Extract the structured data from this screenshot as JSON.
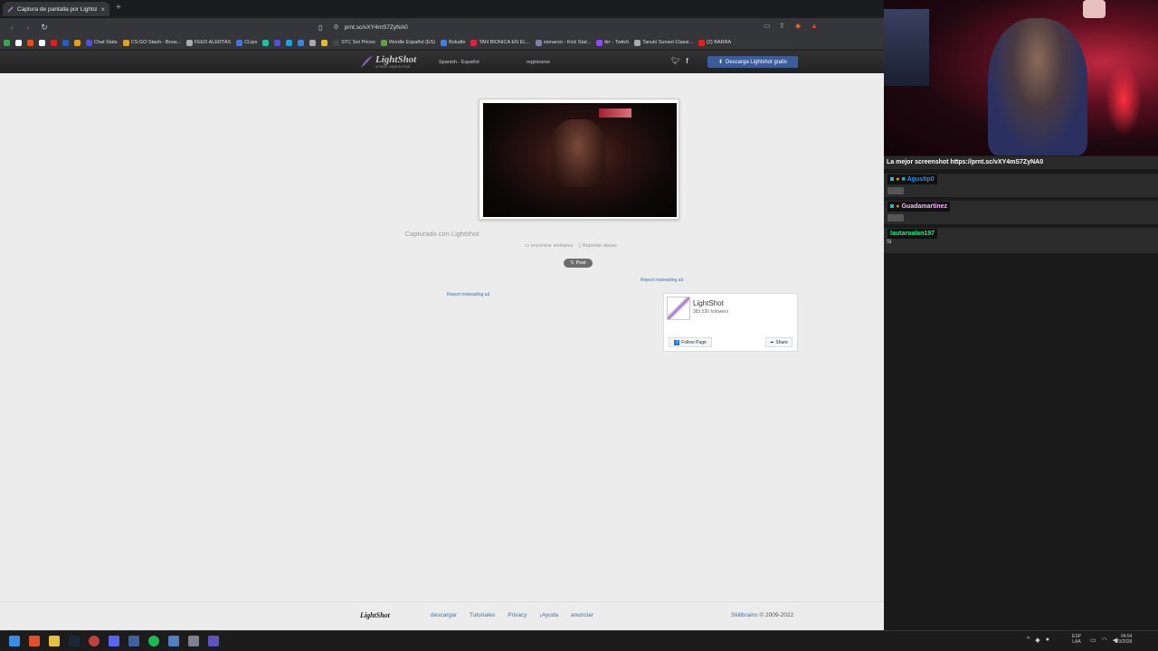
{
  "browser": {
    "tab_title": "Captura de pantalla por Lightshot",
    "tab_close": "×",
    "new_tab": "+",
    "url": "prnt.sc/vXY4mS7ZyNA0",
    "bookmarks": [
      {
        "label": "",
        "color": "#3aa655"
      },
      {
        "label": "",
        "color": "#ffffff"
      },
      {
        "label": "",
        "color": "#e94e1b"
      },
      {
        "label": "",
        "color": "#ffffff"
      },
      {
        "label": "",
        "color": "#e02020"
      },
      {
        "label": "",
        "color": "#2060c0"
      },
      {
        "label": "",
        "color": "#e0a020"
      },
      {
        "label": "Chat Stats",
        "color": "#5050e0"
      },
      {
        "label": "CS:GO Stash - Brow...",
        "color": "#e0a020"
      },
      {
        "label": "FEED ALERTAS",
        "color": "#aaaaaa"
      },
      {
        "label": "CLips",
        "color": "#4a70e0"
      },
      {
        "label": "",
        "color": "#20c0a0"
      },
      {
        "label": "",
        "color": "#5050e0"
      },
      {
        "label": "",
        "color": "#20a0e0"
      },
      {
        "label": "",
        "color": "#4080e0"
      },
      {
        "label": "",
        "color": "#aaaaaa"
      },
      {
        "label": "",
        "color": "#e0c020"
      },
      {
        "label": "STC Set Prices",
        "color": "#444444"
      },
      {
        "label": "Wordle Español (ES)",
        "color": "#60a040"
      },
      {
        "label": "Boludle",
        "color": "#4080e0"
      },
      {
        "label": "TAN BIONICA EN EL...",
        "color": "#e02040"
      },
      {
        "label": "sionaron - Kick Stat...",
        "color": "#8080a0"
      },
      {
        "label": "ttrr - Twitch",
        "color": "#9146ff"
      },
      {
        "label": "Tanuki Sunset Classi...",
        "color": "#aaaaaa"
      },
      {
        "label": "(2) BARRA",
        "color": "#e02020"
      }
    ]
  },
  "lightshot": {
    "logo": "LightShot",
    "logo_sub": "screen capture tool",
    "language": "Spanish - Español",
    "register": "registrarse",
    "download_label": "Descarga Lightshot gratis",
    "captured_with": "Capturado con Lightshot",
    "find_similar": "encontrar similares",
    "report_abuse": "Reportar abuso",
    "post_label": "Post",
    "report_ad_1": "Report misleading ad",
    "report_ad_2": "Report misleading ad",
    "fb": {
      "name": "LightShot",
      "followers": "383,530 followers",
      "follow": "Follow Page",
      "share": "Share"
    },
    "footer": {
      "logo": "LightShot",
      "links": [
        "descargar",
        "Tutoriales",
        "Privacy",
        "¡Ayuda",
        "anunciar"
      ],
      "brand": "Skillbrains",
      "copyright": "© 2009-2022"
    }
  },
  "stream": {
    "title": "La mejor screenshot https://prnt.sc/vXY4mS7ZyNA0",
    "chat": [
      {
        "user": "Agustip0",
        "color": "#1e90ff",
        "message": ""
      },
      {
        "user": "Guadamartinez",
        "color": "#ffb6ff",
        "message": ""
      },
      {
        "user": "lautaroalan197",
        "color": "#00ff7f",
        "message": "Si"
      }
    ]
  },
  "taskbar": {
    "lang_top": "ESP",
    "lang_bottom": "LAA",
    "time": "04:54",
    "date": "1/3/2026"
  }
}
